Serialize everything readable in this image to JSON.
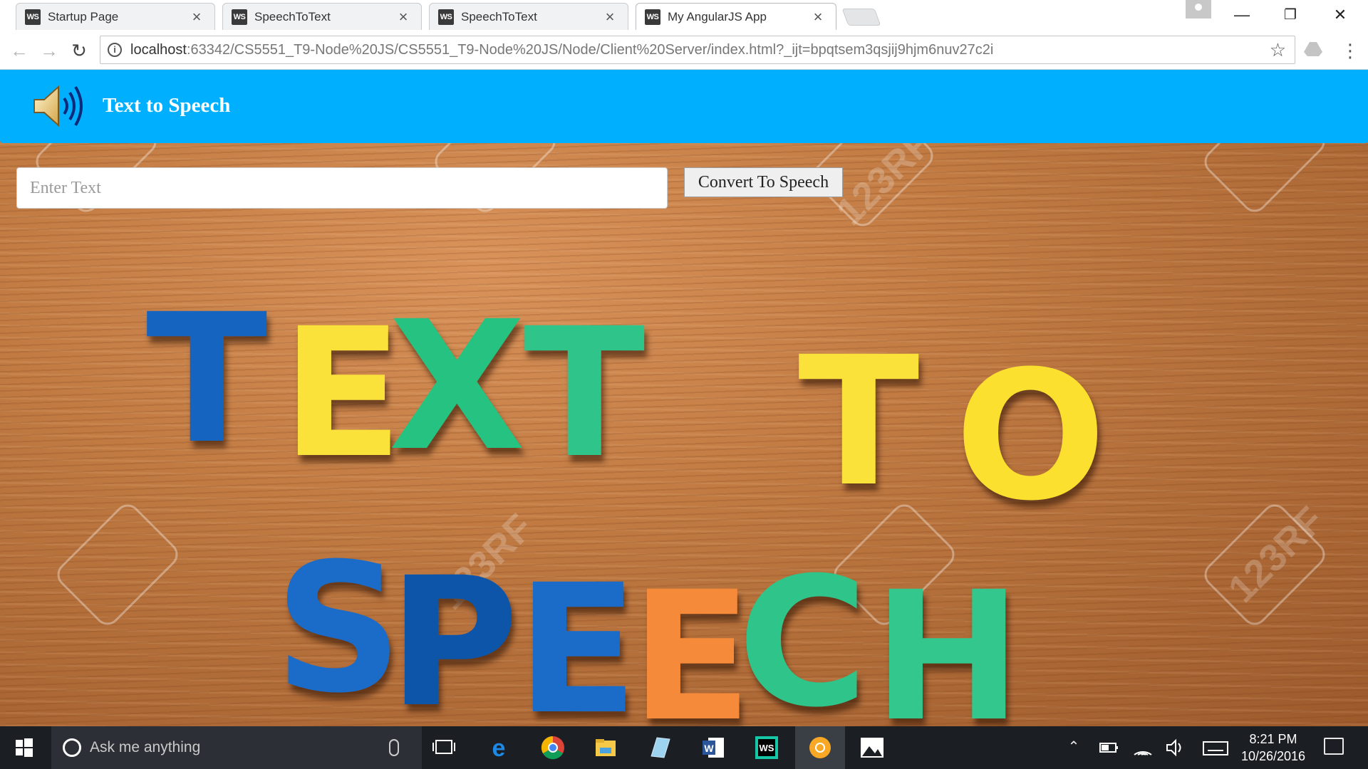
{
  "tabs": [
    {
      "title": "Startup Page",
      "icon": "ws",
      "active": false
    },
    {
      "title": "SpeechToText",
      "icon": "ws",
      "active": false
    },
    {
      "title": "SpeechToText",
      "icon": "ws",
      "active": false
    },
    {
      "title": "My AngularJS App",
      "icon": "ws",
      "active": true
    }
  ],
  "toolbar": {
    "url_host": "localhost",
    "url_rest": ":63342/CS5551_T9-Node%20JS/CS5551_T9-Node%20JS/Node/Client%20Server/index.html?_ijt=bpqtsem3qsjij9hjm6nuv27c2i"
  },
  "app": {
    "title": "Text to Speech",
    "header_color": "#00b0ff",
    "input_placeholder": "Enter Text",
    "input_value": "",
    "convert_label": "Convert To Speech"
  },
  "background_image": {
    "word1": [
      "T",
      "E",
      "X",
      "T"
    ],
    "word2": [
      "T",
      "O"
    ],
    "word3": [
      "S",
      "P",
      "E",
      "E",
      "C",
      "H"
    ],
    "watermark": "123RF"
  },
  "taskbar": {
    "search_placeholder": "Ask me anything",
    "time": "8:21 PM",
    "date": "10/26/2016",
    "pinned_icons": [
      "task-view-icon",
      "edge-icon",
      "chrome-icon",
      "file-explorer-icon",
      "notepad-icon",
      "word-icon",
      "webstorm-icon",
      "chrome-canary-icon",
      "photos-icon"
    ],
    "tray_icons": [
      "chevron-up-icon",
      "battery-icon",
      "wifi-icon",
      "volume-icon",
      "keyboard-icon"
    ]
  }
}
